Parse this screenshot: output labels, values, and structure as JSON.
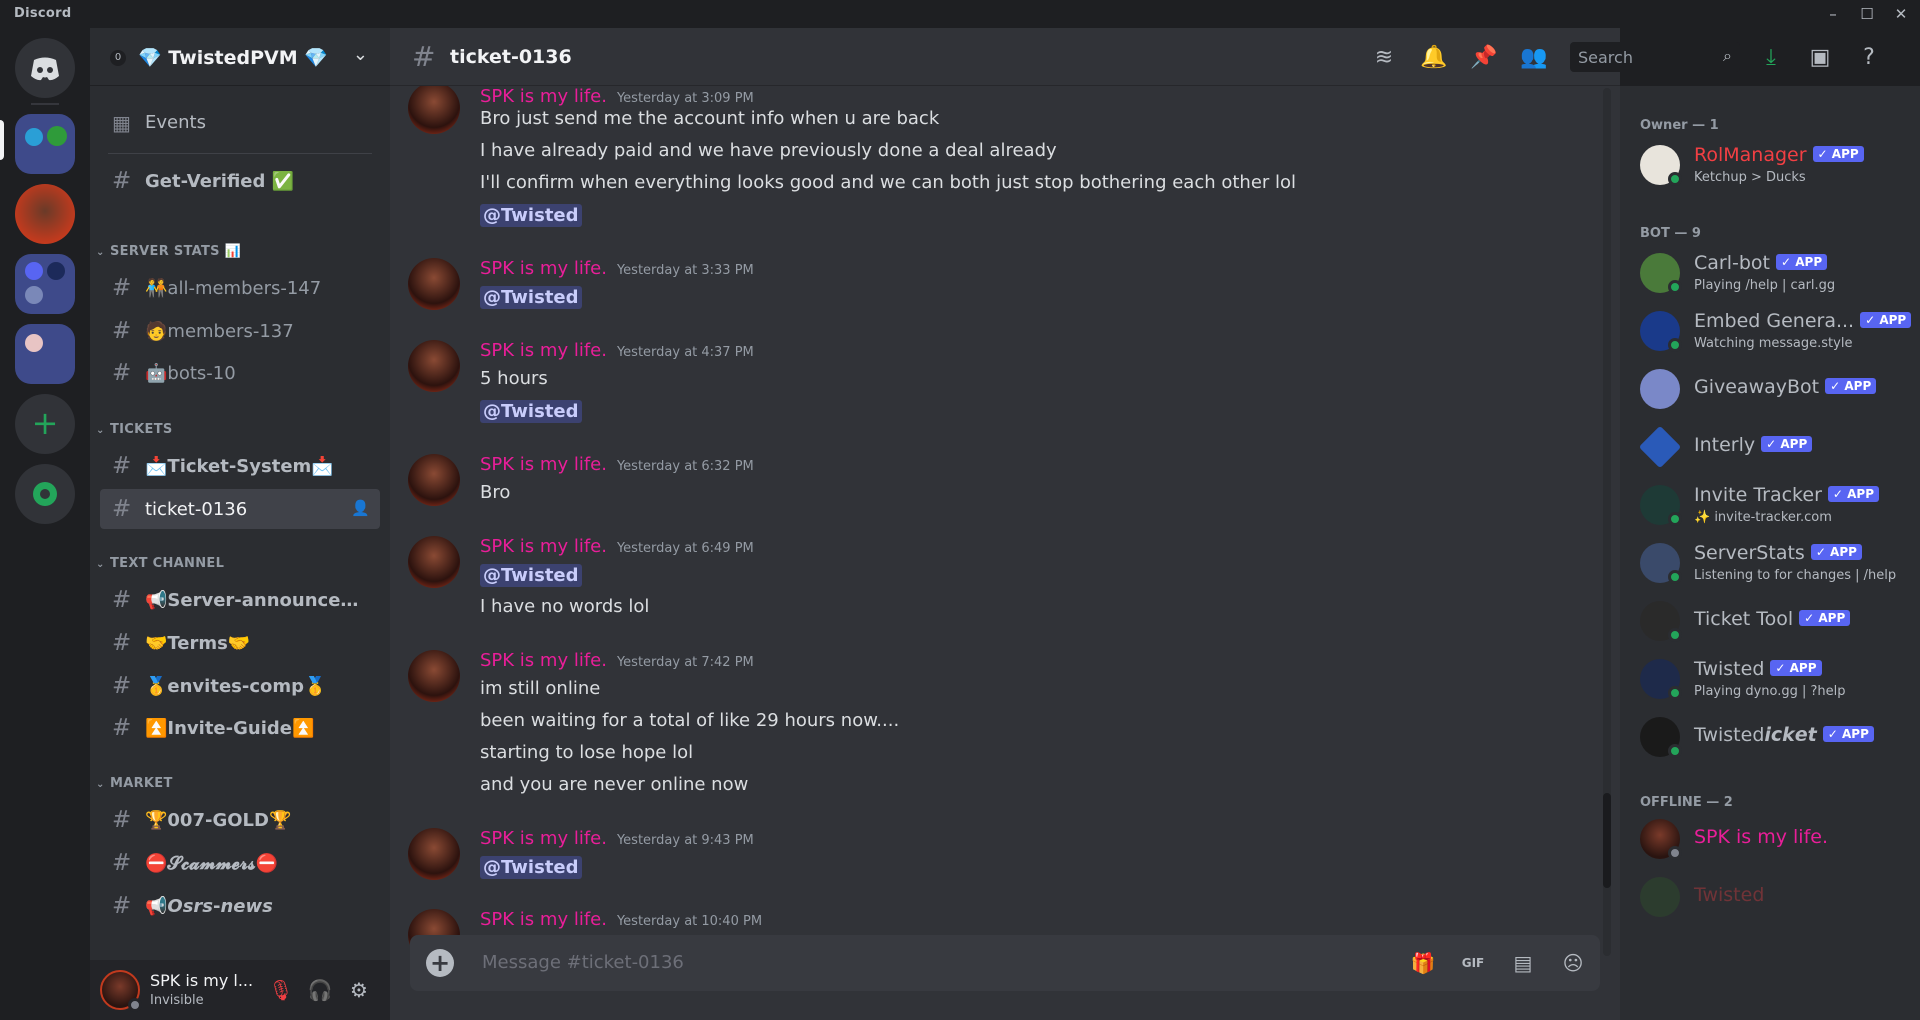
{
  "window": {
    "app_name": "Discord"
  },
  "server": {
    "name": "💎 TwistedPVM 💎",
    "boost_count": "0"
  },
  "sidebar": {
    "events_label": "Events",
    "get_verified": "Get-Verified ✅",
    "categories": {
      "server_stats": "SERVER STATS 📊",
      "tickets": "TICKETS",
      "text_channel": "TEXT CHANNEL",
      "market": "MARKET"
    },
    "channels": {
      "all_members": "🧑‍🤝‍🧑all-members-147",
      "members": "🧑members-137",
      "bots": "🤖bots-10",
      "ticket_system": "📩Ticket-System📩",
      "ticket_0136": "ticket-0136",
      "server_announcements": "📢Server-announceme...",
      "terms": "🤝Terms🤝",
      "envites_comp": "🥇envites-comp🥇",
      "invite_guide": "⏫Invite-Guide⏫",
      "gold": "🏆007-GOLD🏆",
      "scammers": "⛔𝓢𝓬𝓪𝓶𝓶𝓮𝓻𝓼⛔",
      "osrs_news": "📢𝙊𝙨𝙧𝙨-𝙣𝙚𝙬𝙨"
    }
  },
  "user_panel": {
    "name": "SPK is my l...",
    "status": "Invisible"
  },
  "channel_header": {
    "title": "ticket-0136",
    "search_placeholder": "Search"
  },
  "messages": [
    {
      "author": "SPK is my life.",
      "time": "Yesterday at 3:09 PM",
      "lines": [
        "Bro just send me the account info when u are back",
        "I have already paid and we have previously done a deal already",
        "I'll confirm when everything looks good and we can both just stop bothering each other lol"
      ],
      "mention": "@Twisted"
    },
    {
      "author": "SPK is my life.",
      "time": "Yesterday at 3:33 PM",
      "mention": "@Twisted"
    },
    {
      "author": "SPK is my life.",
      "time": "Yesterday at 4:37 PM",
      "lines": [
        "5 hours"
      ],
      "mention": "@Twisted"
    },
    {
      "author": "SPK is my life.",
      "time": "Yesterday at 6:32 PM",
      "lines": [
        "Bro"
      ]
    },
    {
      "author": "SPK is my life.",
      "time": "Yesterday at 6:49 PM",
      "mention": "@Twisted",
      "lines": [
        "I have no words lol"
      ]
    },
    {
      "author": "SPK is my life.",
      "time": "Yesterday at 7:42 PM",
      "lines": [
        "im still online",
        "been waiting for a total of like 29 hours now....",
        "starting to lose hope lol",
        "and you are never online now"
      ]
    },
    {
      "author": "SPK is my life.",
      "time": "Yesterday at 9:43 PM",
      "mention": "@Twisted"
    },
    {
      "author": "SPK is my life.",
      "time": "Yesterday at 10:40 PM"
    }
  ],
  "composer": {
    "placeholder": "Message #ticket-0136"
  },
  "members": {
    "owner_header": "Owner — 1",
    "bot_header": "BOT — 9",
    "offline_header": "OFFLINE — 2",
    "app_tag": "✓ APP",
    "list": [
      {
        "name": "RolManager",
        "sub": "Ketchup > Ducks"
      },
      {
        "name": "Carl-bot",
        "sub": "Playing /help | carl.gg"
      },
      {
        "name": "Embed Genera...",
        "sub": "Watching message.style"
      },
      {
        "name": "GiveawayBot"
      },
      {
        "name": "Interly"
      },
      {
        "name": "Invite Tracker",
        "sub": "✨ invite-tracker.com"
      },
      {
        "name": "ServerStats",
        "sub": "Listening to for changes | /help"
      },
      {
        "name": "Ticket Tool"
      },
      {
        "name": "Twisted",
        "sub": "Playing dyno.gg | ?help"
      },
      {
        "name": "Twisted𝙞𝙘𝙠𝙚𝙩"
      },
      {
        "name": "SPK is my life."
      },
      {
        "name": "Twisted"
      }
    ]
  },
  "colors": {
    "accent": "#5865f2",
    "author": "#e91e99",
    "owner": "#f23f43",
    "online": "#23a55a"
  }
}
